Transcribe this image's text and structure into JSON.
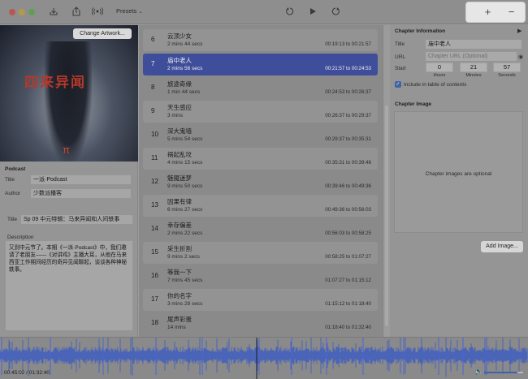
{
  "toolbar": {
    "presets_label": "Presets",
    "add_label": "+",
    "remove_label": "−",
    "icons": [
      "import-icon",
      "share-icon",
      "podcast-icon",
      "undo-icon",
      "play-icon",
      "redo-icon"
    ]
  },
  "artwork": {
    "change_label": "Change Artwork...",
    "title_text": "四来异闻",
    "pi_text": "π"
  },
  "podcast": {
    "section": "Podcast",
    "title_label": "Title",
    "title_value": "一派·Podcast",
    "author_label": "Author",
    "author_value": "少数派播客"
  },
  "episode": {
    "title_label": "Title",
    "title_value": "Sp 09 中元特辑：马来异闻和人间轶事",
    "description_label": "Description",
    "description_value": "又到中元节了。本期《一派·Podcast》中，我们邀请了老朋友——《对讲鸡》主播大耳，从他在马来西亚工作期间经历的奇异见闻聊起，谈谈各种神秘轶事。"
  },
  "chapters": [
    {
      "num": "6",
      "title": "云顶少女",
      "duration": "2 mins 44 secs",
      "range": "00:19:13 to 00:21:57"
    },
    {
      "num": "7",
      "title": "庙中老人",
      "duration": "2 mins 56 secs",
      "range": "00:21:57 to 00:24:53"
    },
    {
      "num": "8",
      "title": "旅途奇缘",
      "duration": "1 min 44 secs",
      "range": "00:24:53 to 00:26:37"
    },
    {
      "num": "9",
      "title": "天生感应",
      "duration": "3 mins",
      "range": "00:26:37 to 00:29:37"
    },
    {
      "num": "10",
      "title": "深大鬼墙",
      "duration": "5 mins 54 secs",
      "range": "00:29:37 to 00:35:31"
    },
    {
      "num": "11",
      "title": "祸起乱坟",
      "duration": "4 mins 15 secs",
      "range": "00:35:31 to 00:39:46"
    },
    {
      "num": "12",
      "title": "魅魇迷梦",
      "duration": "9 mins 50 secs",
      "range": "00:39:46 to 00:49:36"
    },
    {
      "num": "13",
      "title": "因果有律",
      "duration": "6 mins 27 secs",
      "range": "00:49:36 to 00:56:03"
    },
    {
      "num": "14",
      "title": "幸存偏差",
      "duration": "2 mins 22 secs",
      "range": "00:56:03 to 00:58:25"
    },
    {
      "num": "15",
      "title": "采生折割",
      "duration": "9 mins 2 secs",
      "range": "00:58:25 to 01:07:27"
    },
    {
      "num": "16",
      "title": "等我一下",
      "duration": "7 mins 45 secs",
      "range": "01:07:27 to 01:15:12"
    },
    {
      "num": "17",
      "title": "你的名字",
      "duration": "3 mins 28 secs",
      "range": "01:15:12 to 01:18:40"
    },
    {
      "num": "18",
      "title": "尾声彩蛋",
      "duration": "14 mins",
      "range": "01:18:40 to 01:32:40"
    }
  ],
  "selected_index": 1,
  "chapter_info": {
    "section": "Chapter Information",
    "title_label": "Title",
    "title_value": "庙中老人",
    "url_label": "URL",
    "url_placeholder": "Chapter URL (Optional)",
    "start_label": "Start",
    "hours": "0",
    "minutes": "21",
    "seconds": "57",
    "hours_label": "Hours",
    "minutes_label": "Minutes",
    "seconds_label": "Seconds",
    "include_label": "Include in table of contents"
  },
  "chapter_image": {
    "section": "Chapter Image",
    "placeholder": "Chapter images are optional",
    "add_label": "Add Image..."
  },
  "player": {
    "time": "00:45:02 / 01:32:40",
    "progress": 0.486,
    "volume": 0.85
  },
  "colors": {
    "accent": "#3f4e9a",
    "wave": "#3a5bc4",
    "checkbox": "#3f63a6"
  }
}
